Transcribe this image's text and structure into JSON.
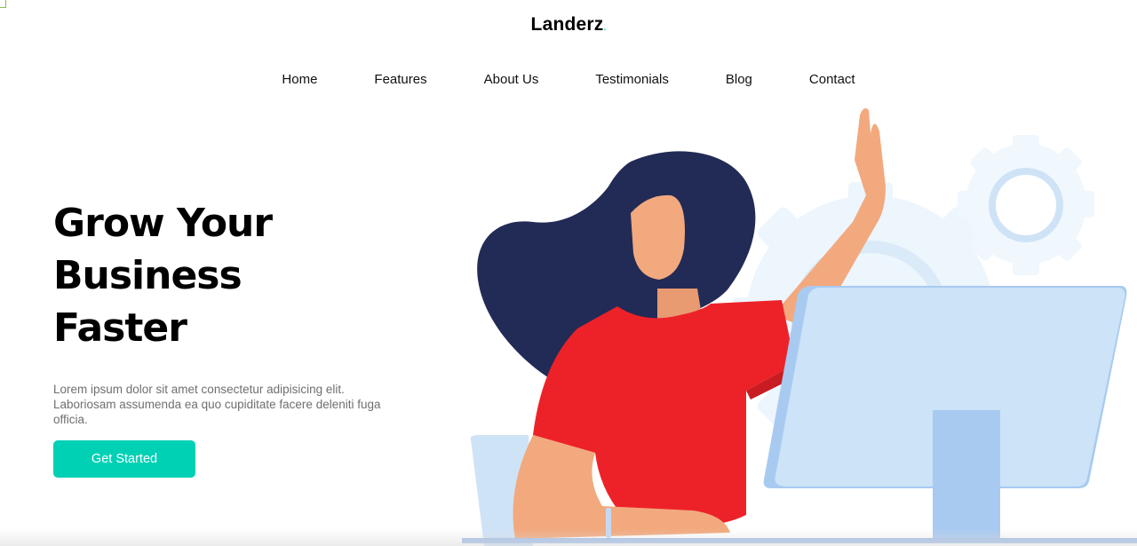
{
  "brand": {
    "name": "Landerz",
    "dot": "."
  },
  "nav": {
    "items": [
      {
        "label": "Home"
      },
      {
        "label": "Features"
      },
      {
        "label": "About Us"
      },
      {
        "label": "Testimonials"
      },
      {
        "label": "Blog"
      },
      {
        "label": "Contact"
      }
    ]
  },
  "hero": {
    "title_lines": [
      "Grow Your",
      "Business",
      "Faster"
    ],
    "description": "Lorem ipsum dolor sit amet consectetur adipisicing elit. Laboriosam assumenda ea quo cupiditate facere deleniti fuga officia.",
    "cta_label": "Get Started"
  },
  "colors": {
    "accent": "#00d1b4",
    "hair": "#222b55",
    "shirt": "#ed2229",
    "skin": "#f2a97e",
    "monitor": "#cce3f8",
    "gear": "#eaf3fc"
  },
  "illustration": {
    "subject": "woman waving at desktop monitor",
    "icons": [
      "gear-icon",
      "monitor-icon"
    ]
  }
}
